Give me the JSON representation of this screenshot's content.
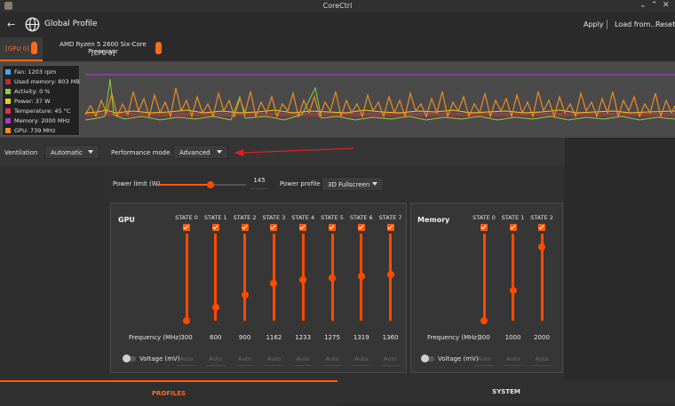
{
  "window": {
    "title": "CoreCtrl"
  },
  "header": {
    "back": "←",
    "title": "Global Profile",
    "apply": "Apply",
    "load_from": "Load from...",
    "reset": "Reset"
  },
  "device_tabs": [
    {
      "label": "[GPU 0]",
      "active": true
    },
    {
      "label_line1": "AMD Ryzen 5 2600 Six-Core Processor",
      "label_line2": "[CPU 0]",
      "active": false
    }
  ],
  "legend": [
    {
      "label": "Fan: 1203 rpm",
      "color": "#4aa8e0",
      "checked": false
    },
    {
      "label": "Used memory: 803 MB",
      "color": "#c03030",
      "checked": true
    },
    {
      "label": "Activity: 0 %",
      "color": "#8ad040",
      "checked": true
    },
    {
      "label": "Power: 37 W",
      "color": "#e8d020",
      "checked": true
    },
    {
      "label": "Temperature: 45 °C",
      "color": "#e03050",
      "checked": true
    },
    {
      "label": "Memory: 2000 MHz",
      "color": "#a040c0",
      "checked": true
    },
    {
      "label": "GPU: 739 MHz",
      "color": "#f08a20",
      "checked": true
    }
  ],
  "ventilation": {
    "label": "Ventilation",
    "value": "Automatic"
  },
  "performance_mode": {
    "label": "Performance mode",
    "value": "Advanced"
  },
  "power_limit": {
    "label": "Power limit (W)",
    "value": "145",
    "fraction": 0.6
  },
  "power_profile": {
    "label": "Power profile",
    "value": "3D Fullscreen"
  },
  "gpu": {
    "title": "GPU",
    "frequency_label": "Frequency (MHz)",
    "voltage_label": "Voltage (mV)",
    "states": [
      {
        "label": "STATE 0",
        "freq": "300",
        "voltage": "Auto",
        "level": 0.0
      },
      {
        "label": "STATE 1",
        "freq": "600",
        "voltage": "Auto",
        "level": 0.15
      },
      {
        "label": "STATE 2",
        "freq": "900",
        "voltage": "Auto",
        "level": 0.3
      },
      {
        "label": "STATE 3",
        "freq": "1162",
        "voltage": "Auto",
        "level": 0.43
      },
      {
        "label": "STATE 4",
        "freq": "1233",
        "voltage": "Auto",
        "level": 0.47
      },
      {
        "label": "STATE 5",
        "freq": "1275",
        "voltage": "Auto",
        "level": 0.49
      },
      {
        "label": "STATE 6",
        "freq": "1319",
        "voltage": "Auto",
        "level": 0.51
      },
      {
        "label": "STATE 7",
        "freq": "1360",
        "voltage": "Auto",
        "level": 0.53
      }
    ]
  },
  "memory": {
    "title": "Memory",
    "frequency_label": "Frequency (MHz)",
    "voltage_label": "Voltage (mV)",
    "states": [
      {
        "label": "STATE 0",
        "freq": "300",
        "voltage": "Auto",
        "level": 0.0
      },
      {
        "label": "STATE 1",
        "freq": "1000",
        "voltage": "Auto",
        "level": 0.35
      },
      {
        "label": "STATE 2",
        "freq": "2000",
        "voltage": "Auto",
        "level": 0.85
      }
    ]
  },
  "bottom_tabs": [
    {
      "label": "PROFILES",
      "active": true
    },
    {
      "label": "SYSTEM",
      "active": false
    }
  ],
  "colors": {
    "accent": "#ff6b1a",
    "graph_bg": "#4a4a4a"
  }
}
